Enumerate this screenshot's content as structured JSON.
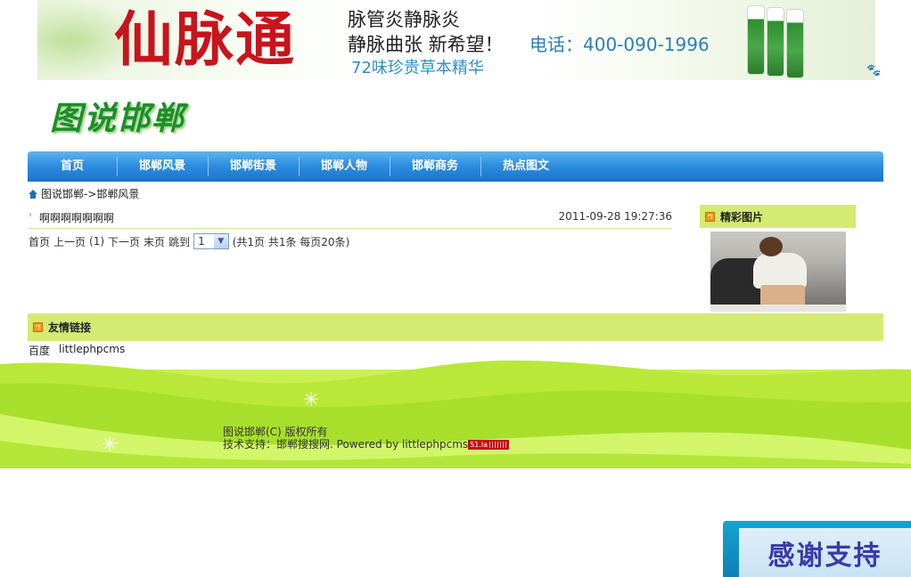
{
  "banner": {
    "brand": "仙脉通",
    "line1": "脉管炎静脉炎",
    "line2": "静脉曲张 新希望！",
    "phone": "电话：400-090-1996",
    "line3": "72味珍贵草本精华"
  },
  "site_logo": "图说邯郸",
  "nav": {
    "items": [
      "首页",
      "邯郸风景",
      "邯郸街景",
      "邯郸人物",
      "邯郸商务",
      "热点图文"
    ]
  },
  "breadcrumb": "图说邯郸->邯郸风景",
  "article": {
    "title": "啊啊啊啊啊啊啊",
    "date": "2011-09-28 19:27:36"
  },
  "pager": {
    "first": "首页",
    "prev": "上一页",
    "current": "(1)",
    "next": "下一页",
    "last": "末页",
    "jump": "跳到",
    "select_value": "1",
    "summary": "(共1页 共1条 每页20条)"
  },
  "side": {
    "title": "精彩图片"
  },
  "friend_links": {
    "title": "友情链接",
    "items": [
      "百度",
      "littlephpcms"
    ]
  },
  "footer": {
    "line1": "图说邯郸(C) 版权所有",
    "line2": "技术支持：邯郸搜搜网. Powered by littlephpcms",
    "badge": "51.la"
  },
  "thanks_button": "感谢支持",
  "colors": {
    "nav": "#2e8fe0",
    "panel": "#d5ea73",
    "brand_red": "#c8141c",
    "footer_green": "#b6e83a"
  }
}
